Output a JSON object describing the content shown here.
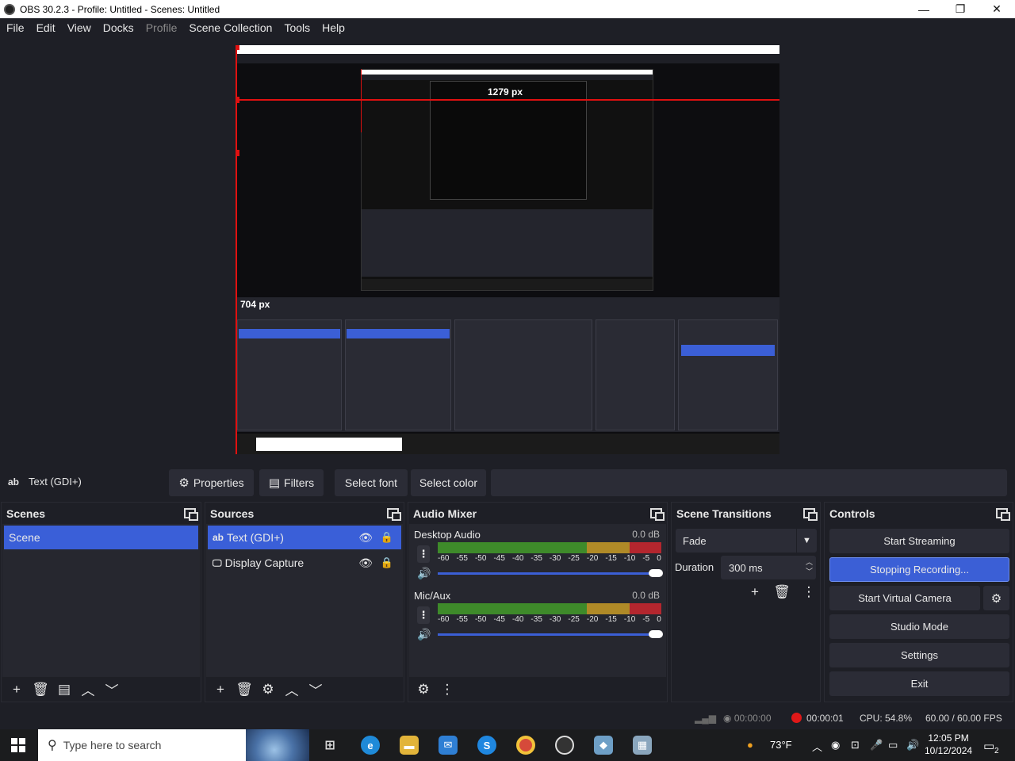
{
  "window": {
    "title": "OBS 30.2.3 - Profile: Untitled - Scenes: Untitled",
    "min": "—",
    "max": "❐",
    "close": "✕"
  },
  "menu": [
    "File",
    "Edit",
    "View",
    "Docks",
    "Profile",
    "Scene Collection",
    "Tools",
    "Help"
  ],
  "preview": {
    "measure_top": "1279 px",
    "measure_left": "704 px"
  },
  "source_toolbar": {
    "current_source_icon": "ab",
    "current_source": "Text (GDI+)",
    "properties": "Properties",
    "filters": "Filters",
    "select_font": "Select font",
    "select_color": "Select color"
  },
  "scenes": {
    "title": "Scenes",
    "items": [
      "Scene"
    ]
  },
  "sources": {
    "title": "Sources",
    "items": [
      {
        "icon": "ab",
        "name": "Text (GDI+)"
      },
      {
        "icon": "display-icon",
        "name": "Display Capture"
      }
    ]
  },
  "mixer": {
    "title": "Audio Mixer",
    "channels": [
      {
        "name": "Desktop Audio",
        "db": "0.0 dB",
        "volume_fraction": 1.0
      },
      {
        "name": "Mic/Aux",
        "db": "0.0 dB",
        "volume_fraction": 1.0
      }
    ],
    "scale": [
      "-60",
      "-55",
      "-50",
      "-45",
      "-40",
      "-35",
      "-30",
      "-25",
      "-20",
      "-15",
      "-10",
      "-5",
      "0"
    ]
  },
  "transitions": {
    "title": "Scene Transitions",
    "selected": "Fade",
    "duration_label": "Duration",
    "duration_value": "300 ms"
  },
  "controls": {
    "title": "Controls",
    "start_streaming": "Start Streaming",
    "recording": "Stopping Recording...",
    "virtual_camera": "Start Virtual Camera",
    "studio_mode": "Studio Mode",
    "settings": "Settings",
    "exit": "Exit"
  },
  "status": {
    "stream_time": "00:00:00",
    "rec_time": "00:00:01",
    "cpu": "CPU: 54.8%",
    "fps": "60.00 / 60.00 FPS"
  },
  "taskbar": {
    "search_placeholder": "Type here to search",
    "weather": "73°F",
    "time": "12:05 PM",
    "date": "10/12/2024",
    "notif_count": "2"
  },
  "colors": {
    "accent": "#3b5fd6",
    "recording_dot": "#e01818",
    "dock_bg": "#1e1f26",
    "meter_green": "#3e8a2a",
    "meter_yellow": "#b08a27",
    "meter_red": "#b3262e"
  }
}
